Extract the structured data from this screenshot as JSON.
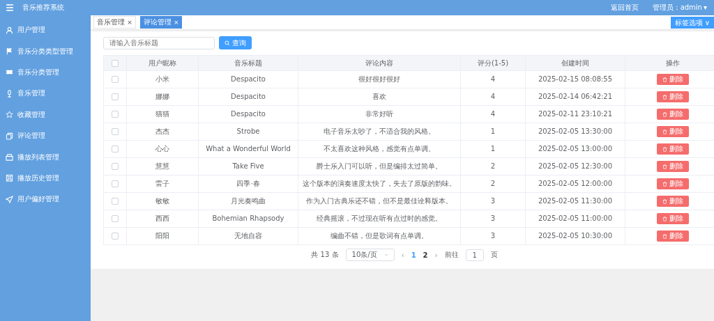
{
  "header": {
    "title": "音乐推荐系统",
    "links": [
      "返回首页"
    ],
    "user": "管理员：admin",
    "user_caret": "▾"
  },
  "sidebar": {
    "items": [
      {
        "label": "用户管理"
      },
      {
        "label": "音乐分类类型管理"
      },
      {
        "label": "音乐分类管理"
      },
      {
        "label": "音乐管理"
      },
      {
        "label": "收藏管理"
      },
      {
        "label": "评论管理"
      },
      {
        "label": "播放列表管理"
      },
      {
        "label": "播放历史管理"
      },
      {
        "label": "用户偏好管理"
      }
    ]
  },
  "tabs": [
    {
      "label": "音乐管理",
      "close": "×",
      "selected": false
    },
    {
      "label": "评论管理",
      "close": "×",
      "selected": true
    }
  ],
  "tab_options": {
    "label": "标签选项",
    "caret": "∨"
  },
  "search": {
    "placeholder": "请输入音乐标题",
    "button": "查询"
  },
  "table": {
    "header_checked": false,
    "columns": [
      "用户昵称",
      "音乐标题",
      "评论内容",
      "评分(1-5)",
      "创建时间",
      "操作"
    ],
    "rows": [
      {
        "checked": false,
        "cells": [
          "小米",
          "Despacito",
          "很好很好很好",
          "4",
          "2025-02-15 08:08:55"
        ],
        "action": "删除"
      },
      {
        "checked": false,
        "cells": [
          "娜娜",
          "Despacito",
          "喜欢",
          "4",
          "2025-02-14 06:42:21"
        ],
        "action": "删除"
      },
      {
        "checked": false,
        "cells": [
          "猫猫",
          "Despacito",
          "非常好听",
          "4",
          "2025-02-11 23:10:21"
        ],
        "action": "删除"
      },
      {
        "checked": false,
        "cells": [
          "杰杰",
          "Strobe",
          "电子音乐太吵了，不适合我的风格。",
          "1",
          "2025-02-05 13:30:00"
        ],
        "action": "删除"
      },
      {
        "checked": false,
        "cells": [
          "心心",
          "What a Wonderful World",
          "不太喜欢这种风格，感觉有点单调。",
          "1",
          "2025-02-05 13:00:00"
        ],
        "action": "删除"
      },
      {
        "checked": false,
        "cells": [
          "慧慧",
          "Take Five",
          "爵士乐入门可以听，但是编排太过简单。",
          "2",
          "2025-02-05 12:30:00"
        ],
        "action": "删除"
      },
      {
        "checked": false,
        "cells": [
          "雷子",
          "四季·春",
          "这个版本的演奏速度太快了，失去了原版的韵味。",
          "2",
          "2025-02-05 12:00:00"
        ],
        "action": "删除"
      },
      {
        "checked": false,
        "cells": [
          "敏敏",
          "月光奏鸣曲",
          "作为入门古典乐还不错，但不是最佳诠释版本。",
          "3",
          "2025-02-05 11:30:00"
        ],
        "action": "删除"
      },
      {
        "checked": false,
        "cells": [
          "西西",
          "Bohemian Rhapsody",
          "经典摇滚，不过现在听有点过时的感觉。",
          "3",
          "2025-02-05 11:00:00"
        ],
        "action": "删除"
      },
      {
        "checked": false,
        "cells": [
          "阳阳",
          "无地自容",
          "编曲不错，但是歌词有点单调。",
          "3",
          "2025-02-05 10:30:00"
        ],
        "action": "删除"
      }
    ]
  },
  "pagination": {
    "total": "共 13 条",
    "page_size": "10条/页",
    "prev": "‹",
    "pages": [
      {
        "label": "1",
        "selected": true
      },
      {
        "label": "2",
        "selected": false
      }
    ],
    "next": "›",
    "goto_label": "前往",
    "goto_value": "1",
    "goto_suffix": "页"
  }
}
